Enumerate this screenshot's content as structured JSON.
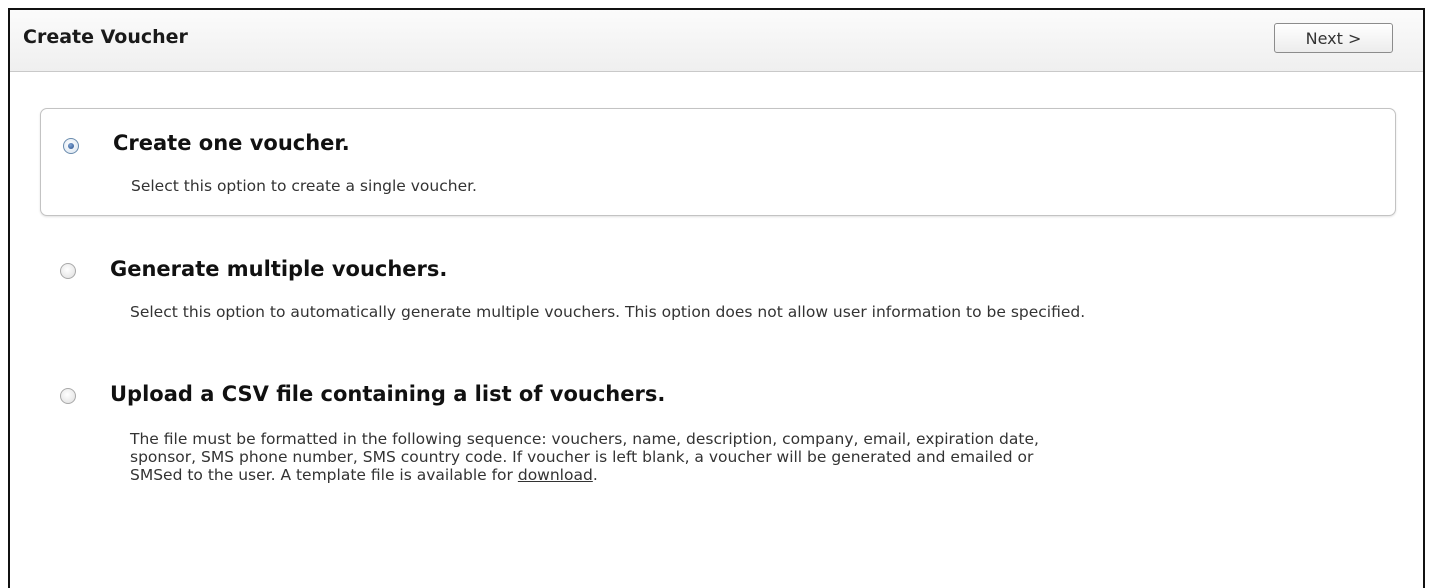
{
  "header": {
    "title": "Create Voucher",
    "next_label": "Next >"
  },
  "options": [
    {
      "title": "Create one voucher.",
      "description": "Select this option to create a single voucher.",
      "selected": true
    },
    {
      "title": "Generate multiple vouchers.",
      "description": "Select this option to automatically generate multiple vouchers. This option does not allow user information to be specified.",
      "selected": false
    },
    {
      "title": "Upload a CSV file containing a list of vouchers.",
      "description_lines": [
        "The file must be formatted in the following sequence: vouchers, name, description, company, email, expiration date,",
        "sponsor, SMS phone number, SMS country code. If voucher is left blank, a voucher will be generated and emailed or",
        "SMSed to the user. A template file is available for"
      ],
      "link_text": "download",
      "after_link": ".",
      "selected": false
    }
  ]
}
